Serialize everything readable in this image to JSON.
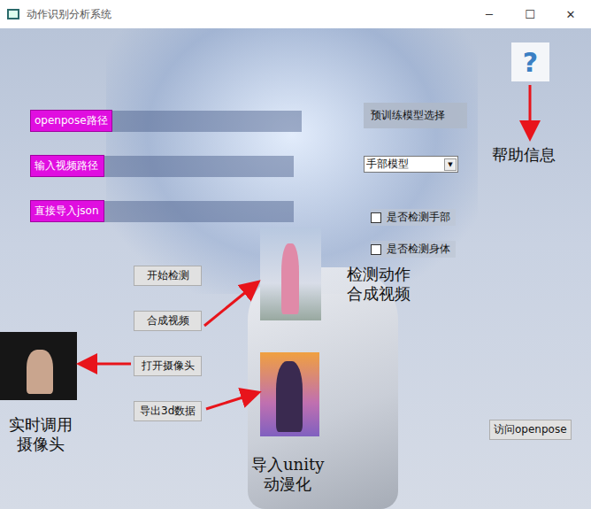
{
  "window": {
    "title": "动作识别分析系统",
    "controls": [
      "─",
      "☐",
      "✕"
    ]
  },
  "path_rows": [
    {
      "label": "openpose路径"
    },
    {
      "label": "输入视频路径"
    },
    {
      "label": "直接导入json"
    }
  ],
  "model_select": {
    "label": "预训练模型选择",
    "value": "手部模型",
    "arrow": "▼"
  },
  "checkboxes": [
    {
      "label": "是否检测手部",
      "checked": false
    },
    {
      "label": "是否检测身体",
      "checked": false
    }
  ],
  "actions": [
    "开始检测",
    "合成视频",
    "打开摄像头",
    "导出3d数据"
  ],
  "help": {
    "icon": "?"
  },
  "visit_button": "访问openpose",
  "annotations": [
    {
      "lines": [
        "帮助信息"
      ]
    },
    {
      "lines": [
        "检测动作",
        "合成视频"
      ]
    },
    {
      "lines": [
        "实时调用",
        "摄像头"
      ]
    },
    {
      "lines": [
        "导入unity",
        "动漫化"
      ]
    }
  ]
}
